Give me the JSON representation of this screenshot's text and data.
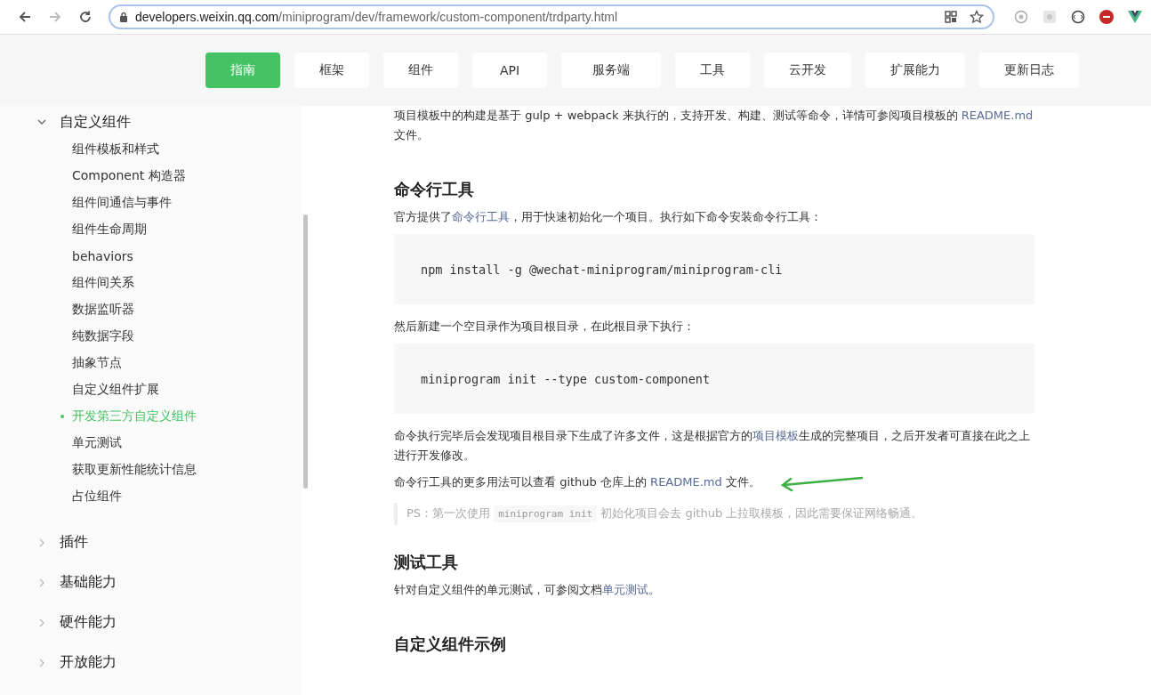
{
  "browser": {
    "url_host": "developers.weixin.qq.com",
    "url_path": "/miniprogram/dev/framework/custom-component/trdparty.html"
  },
  "nav": [
    {
      "label": "指南",
      "selected": true
    },
    {
      "label": "框架",
      "selected": false
    },
    {
      "label": "组件",
      "selected": false
    },
    {
      "label": "API",
      "selected": false
    },
    {
      "label": "服务端",
      "selected": false
    },
    {
      "label": "工具",
      "selected": false
    },
    {
      "label": "云开发",
      "selected": false
    },
    {
      "label": "扩展能力",
      "selected": false
    },
    {
      "label": "更新日志",
      "selected": false
    }
  ],
  "sidebar": [
    {
      "label": "自定义组件",
      "expanded": true,
      "children": [
        {
          "label": "组件模板和样式",
          "selected": false
        },
        {
          "label": "Component 构造器",
          "selected": false
        },
        {
          "label": "组件间通信与事件",
          "selected": false
        },
        {
          "label": "组件生命周期",
          "selected": false
        },
        {
          "label": "behaviors",
          "selected": false
        },
        {
          "label": "组件间关系",
          "selected": false
        },
        {
          "label": "数据监听器",
          "selected": false
        },
        {
          "label": "纯数据字段",
          "selected": false
        },
        {
          "label": "抽象节点",
          "selected": false
        },
        {
          "label": "自定义组件扩展",
          "selected": false
        },
        {
          "label": "开发第三方自定义组件",
          "selected": true
        },
        {
          "label": "单元测试",
          "selected": false
        },
        {
          "label": "获取更新性能统计信息",
          "selected": false
        },
        {
          "label": "占位组件",
          "selected": false
        }
      ]
    },
    {
      "label": "插件",
      "expanded": false
    },
    {
      "label": "基础能力",
      "expanded": false
    },
    {
      "label": "硬件能力",
      "expanded": false
    },
    {
      "label": "开放能力",
      "expanded": false
    }
  ],
  "content": [
    {
      "kind": "para",
      "parts": [
        {
          "text": "项目模板中的构建是基于 gulp + webpack 来执行的，支持开发、构建、测试等命令，详情可参阅项目模板的 "
        },
        {
          "text": "README.md",
          "link": true
        },
        {
          "text": " 文件。"
        }
      ]
    },
    {
      "kind": "heading",
      "text": "命令行工具"
    },
    {
      "kind": "para",
      "parts": [
        {
          "text": "官方提供了"
        },
        {
          "text": "命令行工具",
          "link": true
        },
        {
          "text": "，用于快速初始化一个项目。执行如下命令安装命令行工具："
        }
      ]
    },
    {
      "kind": "code",
      "text": "npm install -g @wechat-miniprogram/miniprogram-cli"
    },
    {
      "kind": "para",
      "parts": [
        {
          "text": "然后新建一个空目录作为项目根目录，在此根目录下执行："
        }
      ]
    },
    {
      "kind": "code",
      "text": "miniprogram init --type custom-component"
    },
    {
      "kind": "para",
      "parts": [
        {
          "text": "命令执行完毕后会发现项目根目录下生成了许多文件，这是根据官方的"
        },
        {
          "text": "项目模板",
          "link": true
        },
        {
          "text": "生成的完整项目，之后开发者可直接在此之上进行开发修改。"
        }
      ]
    },
    {
      "kind": "para",
      "arrow": true,
      "parts": [
        {
          "text": "命令行工具的更多用法可以查看 github 仓库上的 "
        },
        {
          "text": "README.md",
          "link": true
        },
        {
          "text": " 文件。"
        }
      ]
    },
    {
      "kind": "quote",
      "parts": [
        {
          "text": "PS：第一次使用 "
        },
        {
          "text": "miniprogram init",
          "code": true
        },
        {
          "text": " 初始化项目会去 github 上拉取模板，因此需要保证网络畅通。"
        }
      ]
    },
    {
      "kind": "heading",
      "text": "测试工具"
    },
    {
      "kind": "para",
      "parts": [
        {
          "text": "针对自定义组件的单元测试，可参阅文档"
        },
        {
          "text": "单元测试",
          "link": true
        },
        {
          "text": "。"
        }
      ]
    },
    {
      "kind": "heading",
      "text": "自定义组件示例"
    }
  ]
}
